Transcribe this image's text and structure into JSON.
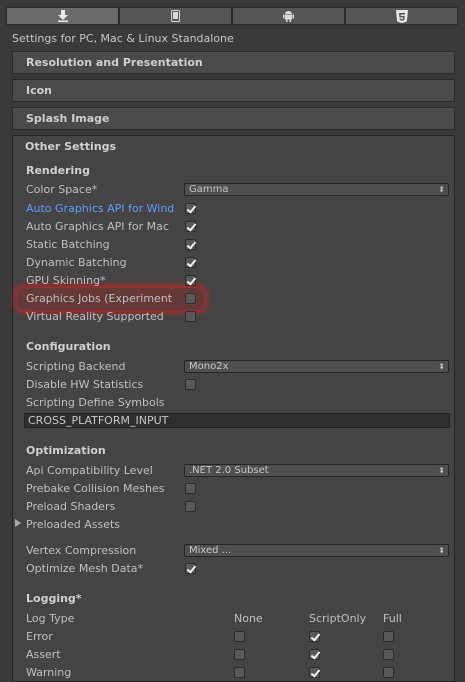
{
  "platform_tabs": [
    {
      "icon": "standalone-download-icon",
      "active": true
    },
    {
      "icon": "phone-icon",
      "active": false
    },
    {
      "icon": "android-icon",
      "active": false
    },
    {
      "icon": "html5-icon",
      "active": false
    }
  ],
  "subtitle": "Settings for PC, Mac & Linux Standalone",
  "headers": {
    "resolution": "Resolution and Presentation",
    "icon": "Icon",
    "splash": "Splash Image",
    "other": "Other Settings"
  },
  "rendering": {
    "title": "Rendering",
    "color_space_label": "Color Space*",
    "color_space_value": "Gamma",
    "auto_gfx_windows_label": "Auto Graphics API for Wind",
    "auto_gfx_mac_label": "Auto Graphics API for Mac",
    "static_batching_label": "Static Batching",
    "dynamic_batching_label": "Dynamic Batching",
    "gpu_skinning_label": "GPU Skinning*",
    "graphics_jobs_label": "Graphics Jobs (Experiment",
    "vr_label": "Virtual Reality Supported"
  },
  "configuration": {
    "title": "Configuration",
    "scripting_backend_label": "Scripting Backend",
    "scripting_backend_value": "Mono2x",
    "disable_hw_label": "Disable HW Statistics",
    "define_symbols_label": "Scripting Define Symbols",
    "define_symbols_value": "CROSS_PLATFORM_INPUT"
  },
  "optimization": {
    "title": "Optimization",
    "api_label": "Api Compatibility Level",
    "api_value": ".NET 2.0 Subset",
    "prebake_label": "Prebake Collision Meshes",
    "preload_shaders_label": "Preload Shaders",
    "preloaded_assets_label": "Preloaded Assets",
    "vertex_compression_label": "Vertex Compression",
    "vertex_compression_value": "Mixed ...",
    "optimize_mesh_label": "Optimize Mesh Data*"
  },
  "logging": {
    "title": "Logging*",
    "col_type": "Log Type",
    "col_none": "None",
    "col_script": "ScriptOnly",
    "col_full": "Full",
    "rows": [
      {
        "label": "Error",
        "none": false,
        "script": true,
        "full": false
      },
      {
        "label": "Assert",
        "none": false,
        "script": true,
        "full": false
      },
      {
        "label": "Warning",
        "none": false,
        "script": true,
        "full": false
      }
    ]
  },
  "dropdown_arrow": "⬍"
}
